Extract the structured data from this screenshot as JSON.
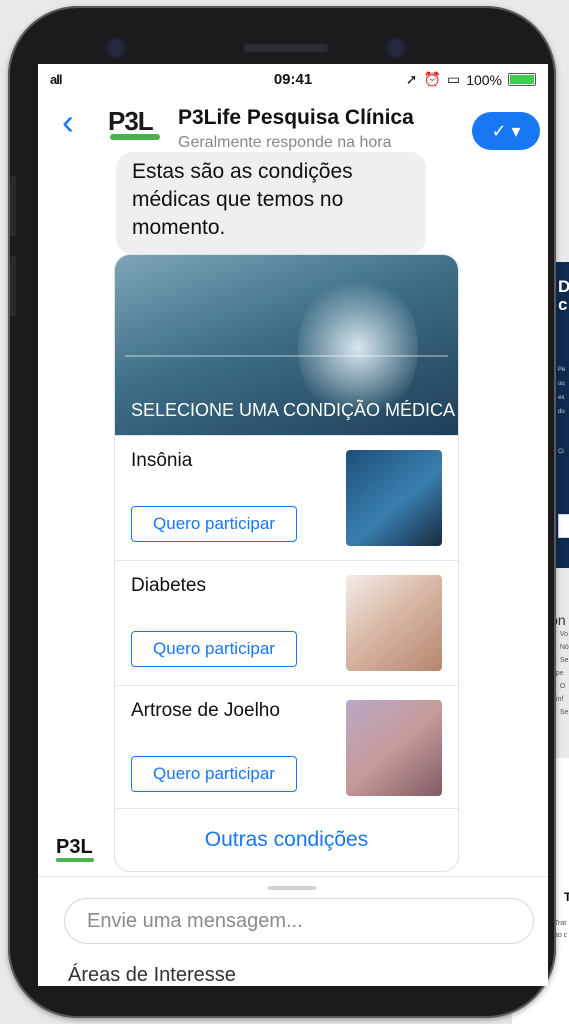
{
  "status": {
    "signal": "all",
    "time": "09:41",
    "battery": "100%",
    "icons": [
      "location-icon",
      "alarm-icon",
      "screen-mirroring-icon",
      "battery-icon"
    ]
  },
  "header": {
    "back_icon": "chevron-left-icon",
    "logo_text": "P3L",
    "title": "P3Life Pesquisa Clínica",
    "subtitle": "Geralmente responde na hora",
    "action_icon": "checkmark-dropdown-icon"
  },
  "chat": {
    "message": "Estas são as condições médicas que temos no momento.",
    "card": {
      "hero_title": "SELECIONE UMA CONDIÇÃO MÉDICA",
      "items": [
        {
          "name": "Insônia",
          "button": "Quero participar"
        },
        {
          "name": "Diabetes",
          "button": "Quero participar"
        },
        {
          "name": "Artrose de Joelho",
          "button": "Quero participar"
        }
      ],
      "more": "Outras condições"
    },
    "avatar_text": "P3L"
  },
  "composer": {
    "placeholder": "Envie uma mensagem...",
    "menu_peek": "Áreas de Interesse"
  },
  "background_page": {
    "headline": "D\nc",
    "lines": [
      "Pe",
      "ou",
      "ex",
      "du",
      "Ci"
    ],
    "section": "Con",
    "checklist": [
      "Vo",
      "Nó",
      "Se",
      "pe",
      "O",
      "inf",
      "Se"
    ],
    "lower_title": "T",
    "lower_text": [
      "Trat",
      "ao c"
    ]
  },
  "colors": {
    "accent": "#1877f2",
    "brand_green": "#48b24f",
    "bubble": "#efeff1",
    "web_header": "#0e2a4f"
  }
}
